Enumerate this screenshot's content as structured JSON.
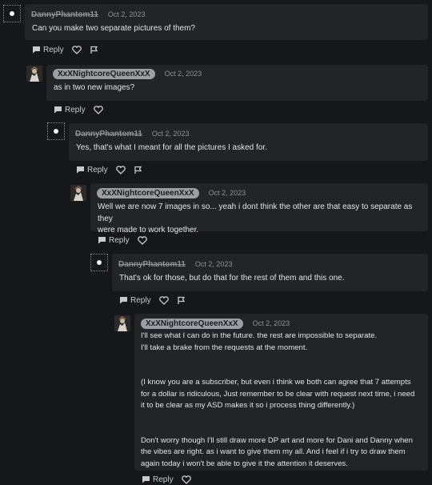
{
  "comments": [
    {
      "username": "DannyPhantom11",
      "date": "Oct 2, 2023",
      "text": [
        "Can you make two separate pictures of them?"
      ],
      "reply_label": "Reply"
    },
    {
      "username": "XxXNightcoreQueenXxX",
      "date": "Oct 2, 2023",
      "text": [
        "as in two new images?"
      ],
      "reply_label": "Reply"
    },
    {
      "username": "DannyPhantom11",
      "date": "Oct 2, 2023",
      "text": [
        "Yes, that's what I meant for all the pictures I asked for."
      ],
      "reply_label": "Reply"
    },
    {
      "username": "XxXNightcoreQueenXxX",
      "date": "Oct 2, 2023",
      "text": [
        "Well we are now 7 images in so... yeah i dont think the other are that easy to separate as they",
        "were made to work together."
      ],
      "reply_label": "Reply"
    },
    {
      "username": "DannyPhantom11",
      "date": "Oct 2, 2023",
      "text": [
        "That's ok for those, but do that for the rest of them and this one."
      ],
      "reply_label": "Reply"
    },
    {
      "username": "XxXNightcoreQueenXxX",
      "date": "Oct 2, 2023",
      "text": [
        "I'll see what I can do in the future. the rest are impossible to separate.",
        "I'll take a brake from the requests at the moment.",
        "",
        "",
        "(I know you are a subscriber, but even i think we both can agree that 7 attempts",
        "for a dollar is ridiculous, Just remember to be clear with request next time, i need",
        "it to be clear as my ASD makes it so i process thing differently.)",
        "",
        "",
        "Don't worry though I'll still draw more DP art and more for Dani and Danny when",
        "the vibes are right. as i want to give them my all. And i feel if i try to draw them",
        "again today i won't be able to give it the attention it deserves."
      ],
      "reply_label": "Reply"
    }
  ],
  "icons": {
    "reply": "speech-bubble-icon",
    "like": "heart-icon",
    "report": "flag-icon"
  }
}
